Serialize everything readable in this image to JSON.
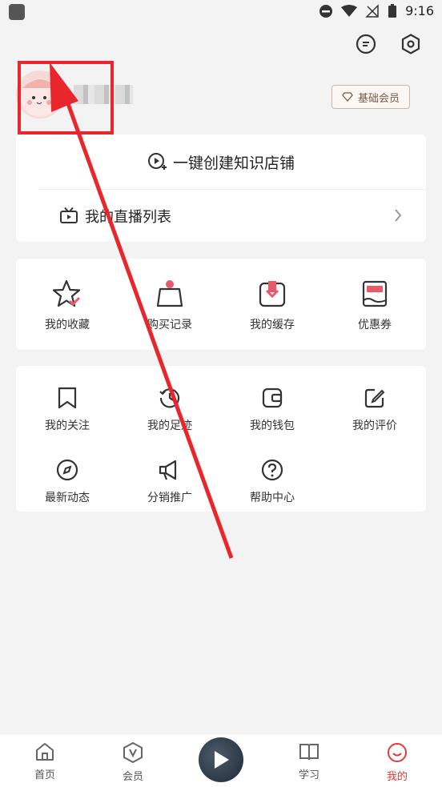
{
  "status_bar": {
    "time": "9:16"
  },
  "profile": {
    "member_badge": "基础会员"
  },
  "card1": {
    "create_shop": "一键创建知识店铺",
    "live_list": "我的直播列表"
  },
  "quick_grid": [
    {
      "label": "我的收藏",
      "icon": "star-icon"
    },
    {
      "label": "购买记录",
      "icon": "shopping-bag-icon"
    },
    {
      "label": "我的缓存",
      "icon": "download-icon"
    },
    {
      "label": "优惠券",
      "icon": "coupon-icon"
    }
  ],
  "tools_grid": [
    {
      "label": "我的关注",
      "icon": "bookmark-icon"
    },
    {
      "label": "我的足迹",
      "icon": "history-icon"
    },
    {
      "label": "我的钱包",
      "icon": "wallet-icon"
    },
    {
      "label": "我的评价",
      "icon": "edit-icon"
    },
    {
      "label": "最新动态",
      "icon": "compass-icon"
    },
    {
      "label": "分销推广",
      "icon": "megaphone-icon"
    },
    {
      "label": "帮助中心",
      "icon": "help-icon"
    }
  ],
  "bottom_nav": [
    {
      "label": "首页",
      "icon": "home-icon"
    },
    {
      "label": "会员",
      "icon": "vip-icon"
    },
    {
      "label": "学习",
      "icon": "book-icon"
    },
    {
      "label": "我的",
      "icon": "profile-icon",
      "active": true
    }
  ],
  "colors": {
    "accent": "#e23a3a",
    "annotation": "#e8262b"
  }
}
